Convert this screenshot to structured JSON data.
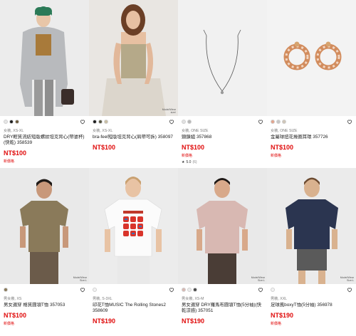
{
  "products": [
    {
      "swatches": [
        "#e6e6e6",
        "#1e1e1e",
        "#6b5a3c"
      ],
      "meta": "女裝, XS-XL",
      "title": "DRY輕質流紡短版螺紋坦克背心(帶罩杯)(快乾) 358539",
      "price": "NT$100",
      "flag": "新價格",
      "model_info": ""
    },
    {
      "swatches": [
        "#1e1e1e",
        "#585743",
        "#c9bfa4"
      ],
      "meta": "女裝, XS-XL",
      "title": "bra-feel短版坦克背心(肩帶可拆) 358097",
      "price": "NT$100",
      "flag": "",
      "model_info": "Model/Wear\nsize/"
    },
    {
      "swatches": [
        "#e2e2e2",
        "#b9b9b9"
      ],
      "meta": "女裝, ONE SIZE",
      "title": "頸鍊組 357868",
      "price": "NT$100",
      "flag": "新價格",
      "rating": "5.0",
      "rating_count": "(6)",
      "model_info": ""
    },
    {
      "swatches": [
        "#e3a58e",
        "#c7c7c7",
        "#cfc6b8"
      ],
      "meta": "女裝, ONE SIZE",
      "title": "金屬球扭花捲圈耳環 357726",
      "price": "NT$100",
      "flag": "新價格",
      "model_info": ""
    },
    {
      "swatches": [
        "#8b7a5a"
      ],
      "meta": "男女裝, XS",
      "title": "男女適穿 格質圓領T恤 357053",
      "price": "NT$100",
      "flag": "新價格",
      "model_info": "Model/Wear\nSize:L"
    },
    {
      "swatches": [
        "#f3f3f3"
      ],
      "meta": "男裝, S-3XL",
      "title": "印花T恤MUSIC The Rolling Stones2 358609",
      "price": "NT$190",
      "flag": "",
      "model_info": ""
    },
    {
      "swatches": [
        "#d8b8b2",
        "#ececec",
        "#4a4a4a"
      ],
      "meta": "男女裝, XS-M",
      "title": "男女適穿 DRY羅馬布圓領T恤(5分袖)(快乾涼感) 357051",
      "price": "NT$190",
      "flag": "",
      "model_info": "Model/Wear\nSize:L"
    },
    {
      "swatches": [
        "#f3f3f3"
      ],
      "meta": "男裝, XXL",
      "title": "足球風boxyT恤(5分袖) 356978",
      "price": "NT$190",
      "flag": "新價格",
      "model_info": "Model/Wear\nSize:L"
    }
  ]
}
